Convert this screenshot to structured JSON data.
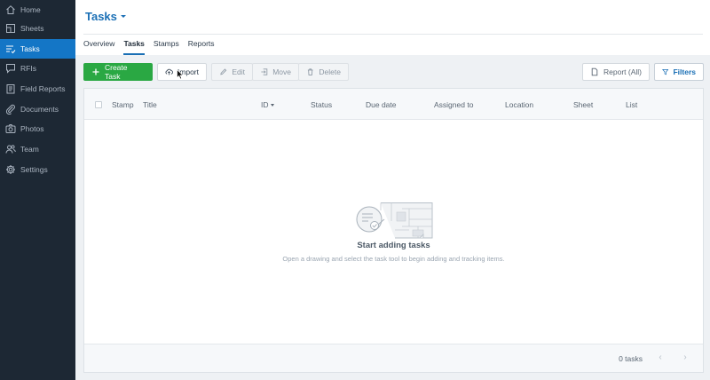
{
  "sidebar": {
    "items": [
      {
        "label": "Home",
        "icon": "home-icon"
      },
      {
        "label": "Sheets",
        "icon": "sheets-icon"
      },
      {
        "label": "Tasks",
        "icon": "tasks-icon",
        "active": true
      },
      {
        "label": "RFIs",
        "icon": "rfis-icon"
      },
      {
        "label": "Field Reports",
        "icon": "field-reports-icon"
      },
      {
        "label": "Documents",
        "icon": "documents-icon"
      },
      {
        "label": "Photos",
        "icon": "photos-icon"
      },
      {
        "label": "Team",
        "icon": "team-icon"
      },
      {
        "label": "Settings",
        "icon": "settings-icon"
      }
    ]
  },
  "header": {
    "title": "Tasks"
  },
  "tabs": [
    {
      "label": "Overview"
    },
    {
      "label": "Tasks",
      "active": true
    },
    {
      "label": "Stamps"
    },
    {
      "label": "Reports"
    }
  ],
  "toolbar": {
    "create": "Create Task",
    "import": "Import",
    "edit": "Edit",
    "move": "Move",
    "delete": "Delete",
    "report": "Report (All)",
    "filters": "Filters"
  },
  "table": {
    "columns": [
      "Stamp",
      "Title",
      "ID",
      "Status",
      "Due date",
      "Assigned to",
      "Location",
      "Sheet",
      "List"
    ]
  },
  "empty_state": {
    "title": "Start adding tasks",
    "subtitle": "Open a drawing and select the task tool to begin adding and tracking items."
  },
  "footer": {
    "count": "0 tasks",
    "prev": "‹",
    "next": "›"
  },
  "colors": {
    "sidebar_bg": "#1d2834",
    "accent": "#1476c6",
    "primary_button": "#2aa843"
  }
}
